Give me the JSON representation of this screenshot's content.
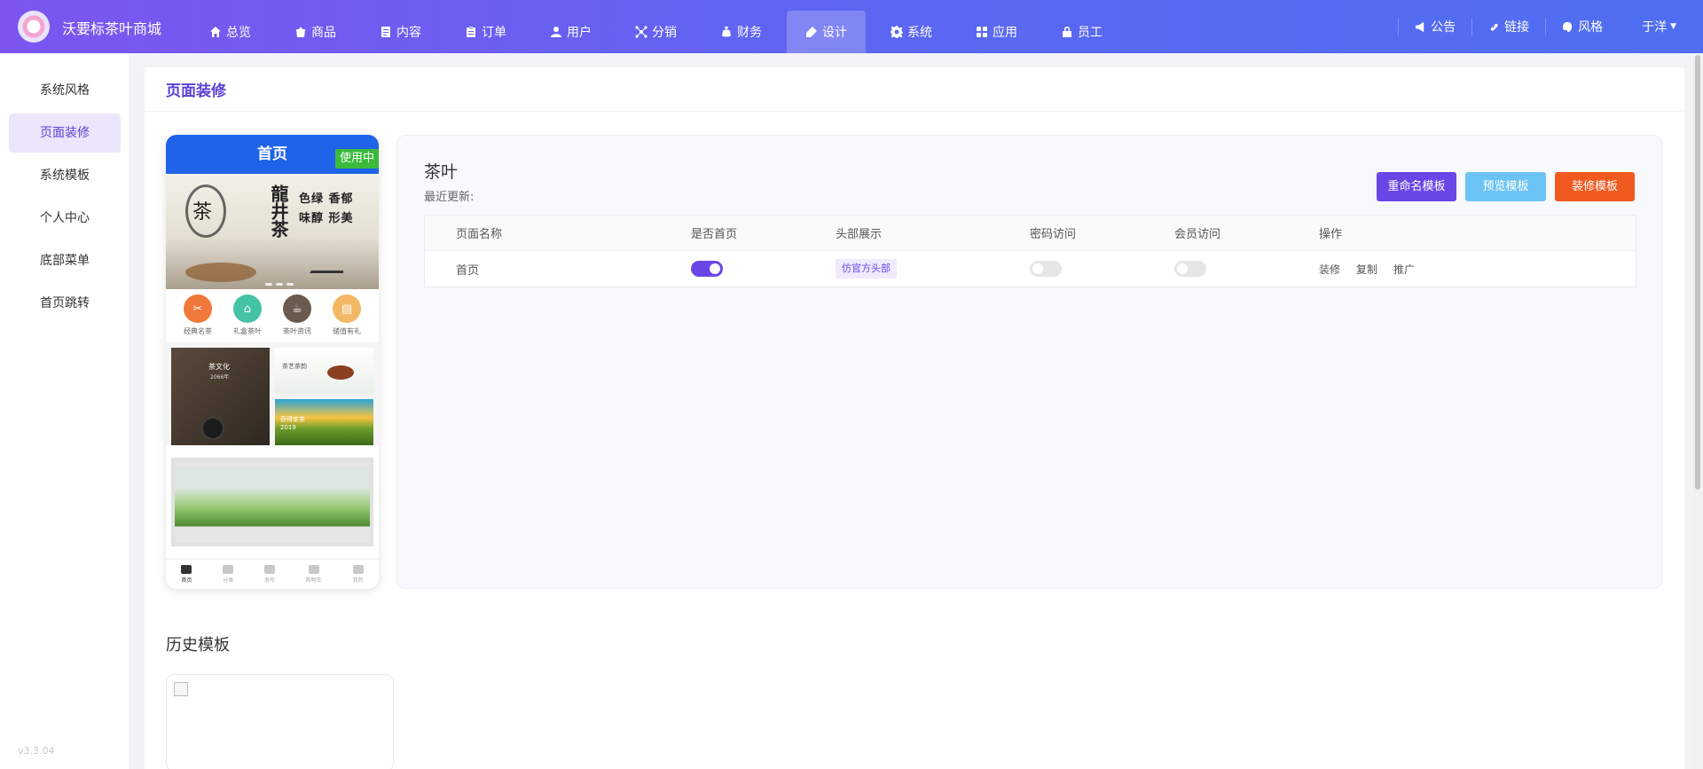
{
  "app": {
    "brand": "沃要标茶叶商城"
  },
  "nav": [
    {
      "label": "总览",
      "icon": "home-icon"
    },
    {
      "label": "商品",
      "icon": "bag-icon"
    },
    {
      "label": "内容",
      "icon": "document-icon"
    },
    {
      "label": "订单",
      "icon": "clipboard-icon"
    },
    {
      "label": "用户",
      "icon": "user-icon"
    },
    {
      "label": "分销",
      "icon": "network-icon"
    },
    {
      "label": "财务",
      "icon": "money-bag-icon"
    },
    {
      "label": "设计",
      "icon": "palette-icon",
      "active": true
    },
    {
      "label": "系统",
      "icon": "gear-icon"
    },
    {
      "label": "应用",
      "icon": "grid-icon"
    },
    {
      "label": "员工",
      "icon": "lock-icon"
    }
  ],
  "tools": {
    "notice": "公告",
    "link": "链接",
    "style": "风格",
    "user": "于洋"
  },
  "sidebar": {
    "items": [
      "系统风格",
      "页面装修",
      "系统模板",
      "个人中心",
      "底部菜单",
      "首页跳转"
    ],
    "active_index": 1,
    "version": "v3.3.04"
  },
  "page": {
    "title": "页面装修"
  },
  "phone": {
    "header": "首页",
    "badge": "使用中",
    "banner": {
      "seal": "茶",
      "vertical": "龍井茶",
      "line1": "色绿 香郁",
      "line2": "味醇 形美"
    },
    "icons": [
      {
        "label": "经典名茶",
        "color": "#f0783a"
      },
      {
        "label": "礼盒茶叶",
        "color": "#45c4a5"
      },
      {
        "label": "茶叶资讯",
        "color": "#6a5a4d"
      },
      {
        "label": "储值有礼",
        "color": "#f3b865"
      }
    ],
    "tiles": {
      "big_title": "茶文化",
      "big_sub": "2066年",
      "small1": "茶艺茶韵",
      "small2": "获得茶茶",
      "small2_sub": "2019"
    },
    "tabbar": [
      "首页",
      "分类",
      "发布",
      "购物车",
      "我的"
    ]
  },
  "template": {
    "name": "茶叶",
    "updated_label": "最近更新:",
    "buttons": {
      "rename": "重命名模板",
      "preview": "预览模板",
      "decorate": "装修模板"
    },
    "columns": [
      "页面名称",
      "是否首页",
      "头部展示",
      "密码访问",
      "会员访问",
      "操作"
    ],
    "rows": [
      {
        "name": "首页",
        "is_home": true,
        "header": "仿官方头部",
        "password": false,
        "member": false,
        "ops": [
          "装修",
          "复制",
          "推广"
        ]
      }
    ]
  },
  "history": {
    "title": "历史模板"
  }
}
